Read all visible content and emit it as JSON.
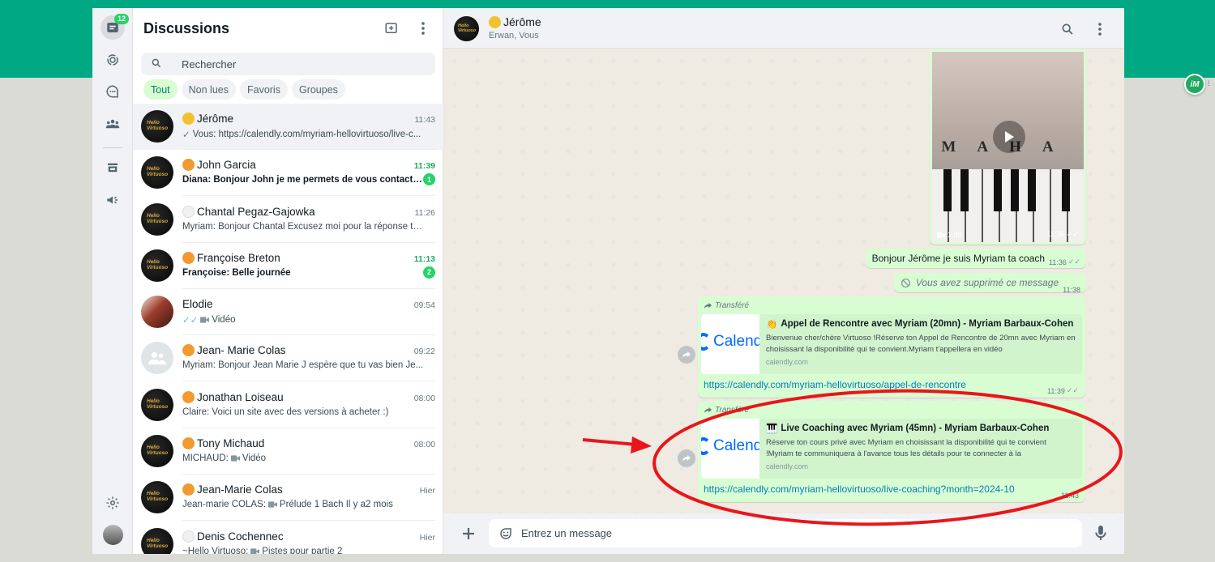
{
  "colors": {
    "brand_green": "#00a884",
    "bubble_out": "#d9fdd3",
    "unread_green": "#25d366",
    "annotation_red": "#e8161b"
  },
  "rail": {
    "chats_badge": "12",
    "icons": [
      "chats-icon",
      "status-icon",
      "channels-icon",
      "communities-icon",
      "catalog-icon",
      "broadcast-icon",
      "settings-icon"
    ]
  },
  "list": {
    "title": "Discussions",
    "search_placeholder": "Rechercher",
    "filters": [
      "Tout",
      "Non lues",
      "Favoris",
      "Groupes"
    ],
    "chats": [
      {
        "name": "Jérôme",
        "dot": "#f2c12e",
        "time": "11:43",
        "preview": "Vous: https://calendly.com/myriam-hellovirtuoso/live-c...",
        "avatar": "logo",
        "tick": "✓",
        "selected": true
      },
      {
        "name": "John Garcia",
        "dot": "#f29930",
        "time": "11:39",
        "preview": "Diana: Bonjour John je me permets de vous contacte...",
        "avatar": "logo",
        "unread": "1"
      },
      {
        "name": "Chantal Pegaz-Gajowka",
        "dot": "#f0f0f0",
        "time": "11:26",
        "preview": "Myriam: Bonjour Chantal  Excusez moi pour la réponse ta...",
        "avatar": "logo"
      },
      {
        "name": "Françoise Breton",
        "dot": "#f29930",
        "time": "11:13",
        "preview": "Françoise: Belle journée",
        "avatar": "logo",
        "unread": "2"
      },
      {
        "name": "Elodie",
        "time": "09:54",
        "preview": "Vidéo",
        "avatar": "photo",
        "tick": "✓✓",
        "media": true
      },
      {
        "name": "Jean- Marie Colas",
        "dot": "#f29930",
        "time": "09:22",
        "preview": "Myriam: Bonjour Jean Marie  J espère que tu vas bien  Je...",
        "avatar": "default"
      },
      {
        "name": "Jonathan Loiseau",
        "dot": "#f29930",
        "time": "08:00",
        "preview": "Claire: Voici un site avec des versions à acheter :)",
        "avatar": "logo"
      },
      {
        "name": "Tony Michaud",
        "dot": "#f29930",
        "time": "08:00",
        "preview": "MICHAUD:",
        "media_label": "Vidéo",
        "avatar": "logo",
        "media": true
      },
      {
        "name": "Jean-Marie Colas",
        "dot": "#f29930",
        "time": "Hier",
        "preview": "Jean-marie COLAS:",
        "media_label": "Prélude 1 Bach Il y a2 mois",
        "avatar": "logo",
        "media": true
      },
      {
        "name": "Denis Cochennec",
        "dot": "#f0f0f0",
        "time": "Hier",
        "preview": "~Hello Virtuoso:",
        "media_label": "Pistes pour partie 2",
        "avatar": "logo",
        "media": true
      }
    ]
  },
  "avatar_logo": {
    "line1": "Hello",
    "line2": "Virtuoso"
  },
  "conversation": {
    "name": "Jérôme",
    "participants": "Erwan, Vous",
    "video": {
      "overlay_text": "MAHA",
      "duration": "1:00",
      "time": "11:36"
    },
    "text_message": {
      "text": "Bonjour Jérôme je suis Myriam ta coach",
      "time": "11:36"
    },
    "deleted_message": {
      "text": "Vous avez supprimé ce message",
      "time": "11:38"
    },
    "forward_1": {
      "label": "Transféré",
      "emoji": "👏",
      "title": "Appel de Rencontre avec Myriam (20mn) - Myriam Barbaux-Cohen",
      "desc": "Bienvenue cher/chère Virtuoso !Réserve ton Appel de Rencontre de 20mn avec Myriam en choisissant la disponibilité qui te convient.Myriam t'appellera en vidéo",
      "domain": "calendly.com",
      "url": "https://calendly.com/myriam-hellovirtuoso/appel-de-rencontre",
      "time": "11:39",
      "thumb_text": "Calendly"
    },
    "forward_2": {
      "label": "Transféré",
      "emoji": "🎹",
      "title": "Live Coaching avec Myriam (45mn) - Myriam Barbaux-Cohen",
      "desc": "Réserve ton cours privé avec Myriam en choisissant la disponibilité qui te convient !Myriam te communiquera à l'avance tous les détails pour te connecter à la",
      "domain": "calendly.com",
      "url": "https://calendly.com/myriam-hellovirtuoso/live-coaching?month=2024-10",
      "time": "11:43",
      "thumb_text": "Calendly"
    },
    "composer_placeholder": "Entrez un message"
  },
  "extension": {
    "label": "iM"
  }
}
